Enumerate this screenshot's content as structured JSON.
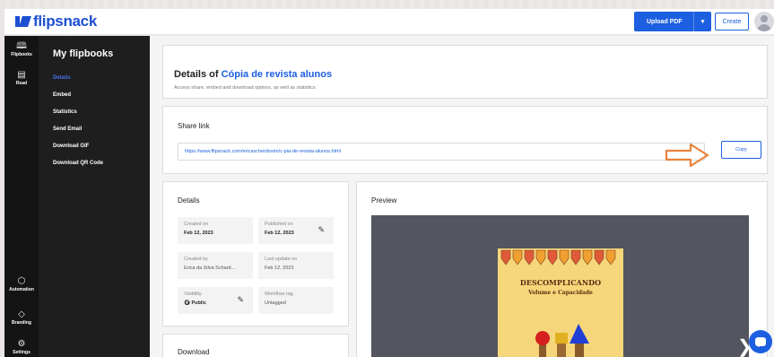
{
  "app": {
    "logo_text": "flipsnack"
  },
  "topbar": {
    "upload_label": "Upload PDF",
    "upload_caret": "▾",
    "create_label": "Create"
  },
  "rail": {
    "items": [
      {
        "label": "Flipbooks",
        "icon": "book-icon"
      },
      {
        "label": "Read",
        "icon": "reader-icon"
      },
      {
        "label": "Automation",
        "icon": "automation-icon"
      },
      {
        "label": "Branding",
        "icon": "diamond-icon"
      },
      {
        "label": "Settings",
        "icon": "gear-icon"
      }
    ]
  },
  "subnav": {
    "title": "My flipbooks",
    "items": [
      {
        "label": "Details",
        "active": true
      },
      {
        "label": "Embed",
        "active": false
      },
      {
        "label": "Statistics",
        "active": false
      },
      {
        "label": "Send Email",
        "active": false
      },
      {
        "label": "Download GIF",
        "active": false
      },
      {
        "label": "Download QR Code",
        "active": false
      }
    ]
  },
  "header": {
    "title_prefix": "Details of ",
    "flipbook_name": "Cópia de revista alunos",
    "subtitle": "Access share, embed and download options, as well as statistics"
  },
  "share": {
    "heading": "Share link",
    "url": "https://www.flipsnack.com/ericascherdosim/c-pia-de-revista-alunos.html",
    "copy_label": "Copy"
  },
  "details": {
    "heading": "Details",
    "created_on_label": "Created on",
    "created_on": "Feb 12, 2023",
    "published_on_label": "Published on",
    "published_on": "Feb 12, 2023",
    "created_by_label": "Created by",
    "created_by": "Erica da Silva Schard...",
    "last_update_label": "Last update on",
    "last_update": "Feb 12, 2023",
    "visibility_label": "Visibility",
    "visibility": "Public",
    "workflow_label": "Workflow tag",
    "workflow": "Untagged"
  },
  "download": {
    "heading": "Download"
  },
  "preview": {
    "heading": "Preview",
    "cover_title": "DESCOMPLICANDO",
    "cover_subtitle": "Volume e Capacidade"
  },
  "colors": {
    "accent": "#1c5fe0",
    "arrow": "#e8823a",
    "cover": "#f6d67a"
  }
}
